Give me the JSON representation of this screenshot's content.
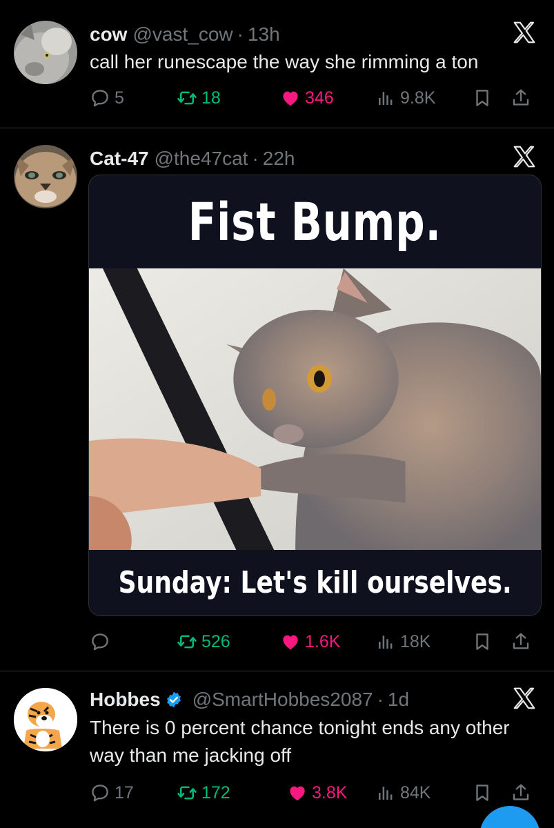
{
  "tweets": [
    {
      "name": "cow",
      "handle": "@vast_cow",
      "dot": "·",
      "time": "13h",
      "text": "call her runescape the way she rimming a ton",
      "replies": "5",
      "reposts": "18",
      "likes": "346",
      "views": "9.8K",
      "avatar_icon": "cat-avatar-icon"
    },
    {
      "name": "Cat-47",
      "handle": "@the47cat",
      "dot": "·",
      "time": "22h",
      "media": {
        "title": "Fist Bump.",
        "caption": "Sunday: Let's kill ourselves."
      },
      "replies": "",
      "reposts": "526",
      "likes": "1.6K",
      "views": "18K",
      "avatar_icon": "cat-avatar-icon"
    },
    {
      "name": "Hobbes",
      "handle": "@SmartHobbes2087",
      "dot": "·",
      "time": "1d",
      "text": "There is 0 percent chance tonight ends any other way than me jacking off",
      "replies": "17",
      "reposts": "172",
      "likes": "3.8K",
      "views": "84K",
      "avatar_icon": "tiger-avatar-icon"
    }
  ],
  "colors": {
    "background": "#000000",
    "text": "#e7e9ea",
    "muted": "#71767b",
    "repost": "#00ba7c",
    "like": "#f91880",
    "verified": "#1d9bf0",
    "divider": "#2f3336"
  }
}
